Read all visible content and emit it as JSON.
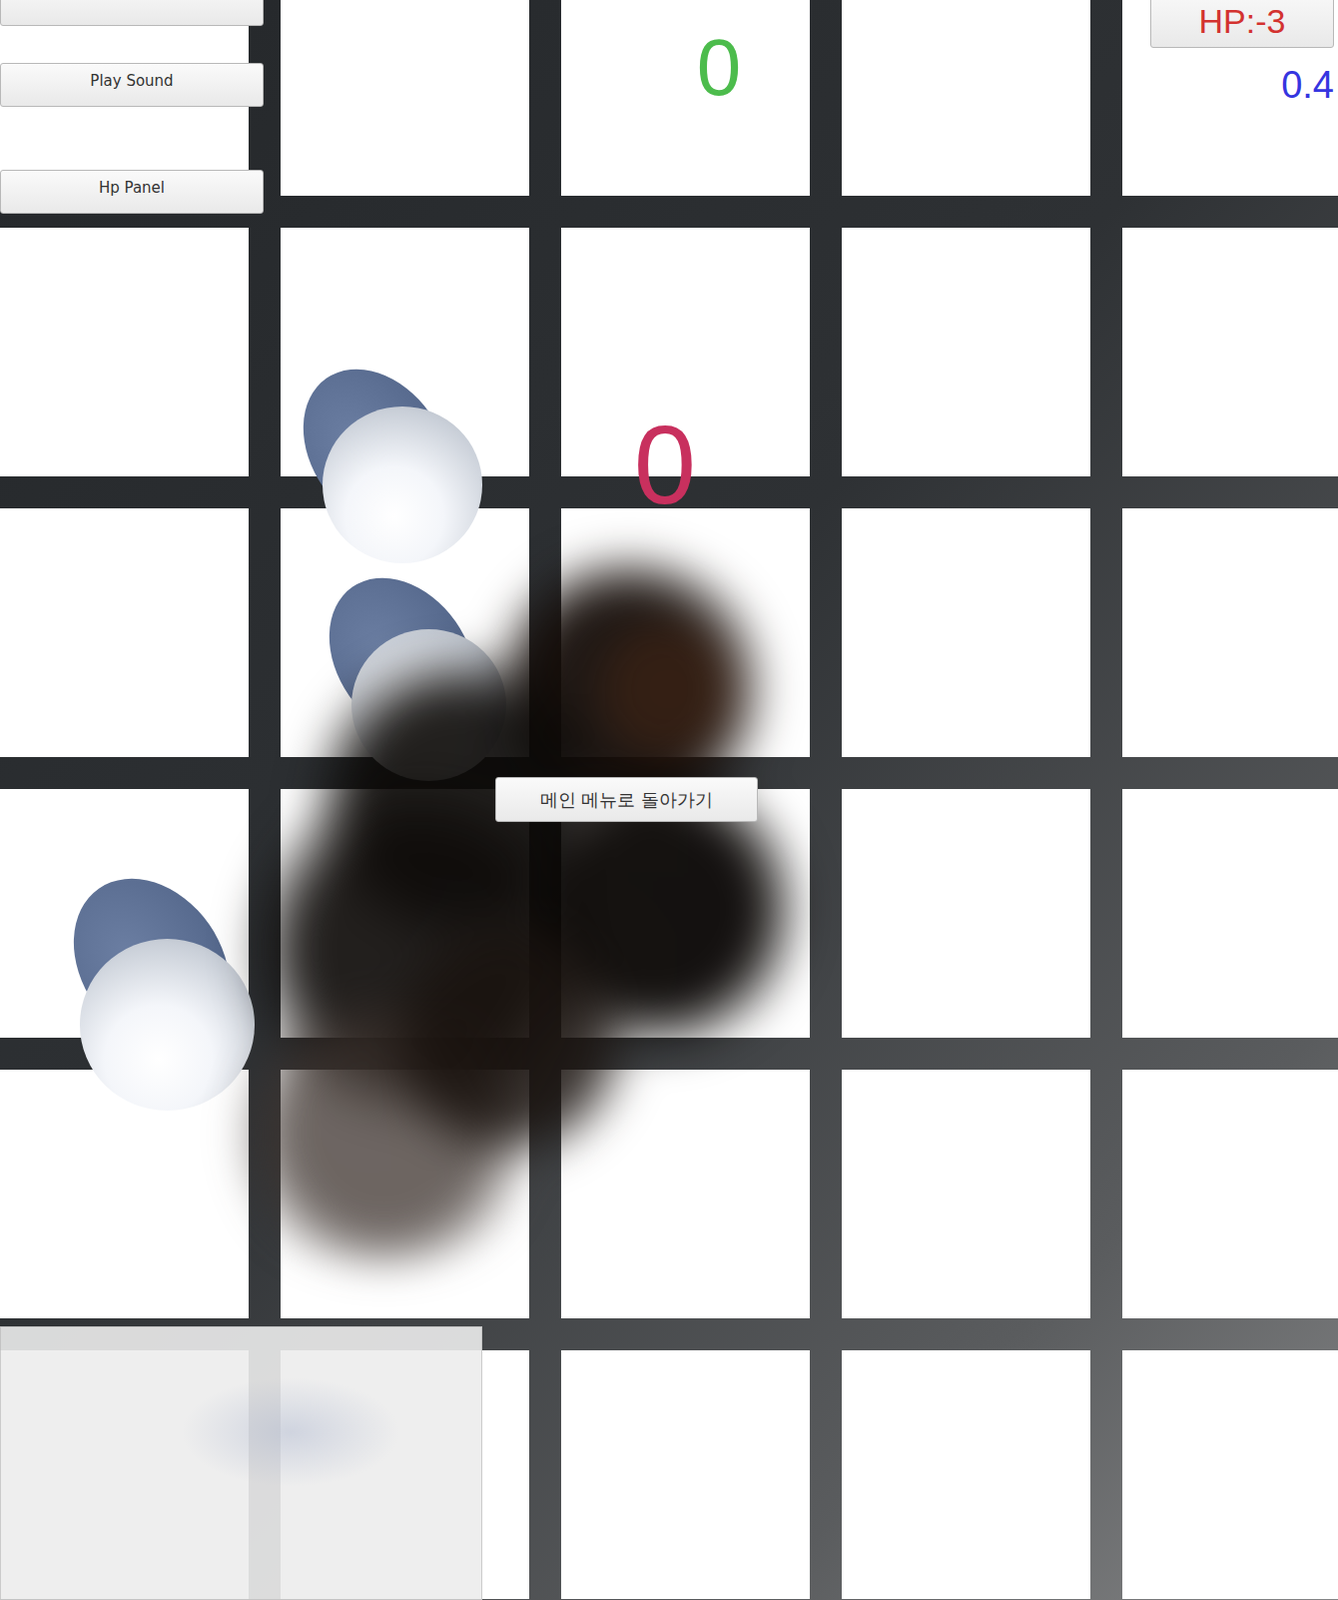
{
  "buttons": [
    {
      "label": "Play Sound"
    },
    {
      "label": "Hp Panel"
    }
  ],
  "score": "0",
  "counter": "0",
  "hp": "HP:-3",
  "timer": "0.4",
  "main_menu_button": "메인 메뉴로 돌아가기"
}
